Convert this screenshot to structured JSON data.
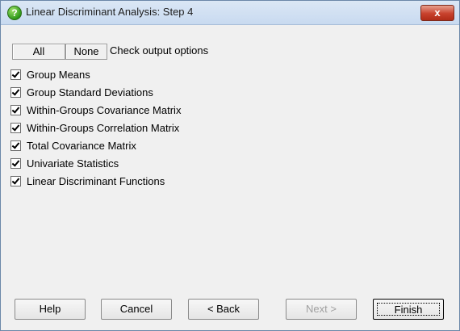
{
  "window": {
    "title": "Linear Discriminant Analysis: Step 4",
    "close_label": "x"
  },
  "toolbar": {
    "all_label": "All",
    "none_label": "None",
    "check_label": "Check output options"
  },
  "options": [
    {
      "label": "Group Means",
      "checked": true
    },
    {
      "label": "Group Standard Deviations",
      "checked": true
    },
    {
      "label": "Within-Groups Covariance Matrix",
      "checked": true
    },
    {
      "label": "Within-Groups Correlation Matrix",
      "checked": true
    },
    {
      "label": "Total Covariance Matrix",
      "checked": true
    },
    {
      "label": "Univariate Statistics",
      "checked": true
    },
    {
      "label": "Linear Discriminant Functions",
      "checked": true
    }
  ],
  "buttons": {
    "help": "Help",
    "cancel": "Cancel",
    "back": "< Back",
    "next": "Next >",
    "finish": "Finish"
  }
}
